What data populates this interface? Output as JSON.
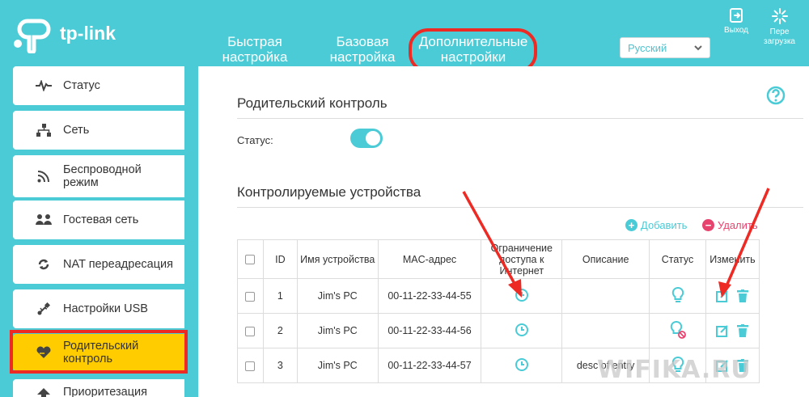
{
  "header": {
    "logo_text": "tp-link",
    "tabs": [
      {
        "line1": "Быстрая",
        "line2": "настройка"
      },
      {
        "line1": "Базовая",
        "line2": "настройка"
      },
      {
        "line1": "Дополнительные",
        "line2": "настройки"
      }
    ],
    "language": "Русский",
    "logout_label": "Выход",
    "reboot_line1": "Пере",
    "reboot_line2": "загрузка"
  },
  "sidebar": {
    "items": [
      {
        "label": "Статус",
        "icon": "pulse-icon"
      },
      {
        "label": "Сеть",
        "icon": "network-icon"
      },
      {
        "label": "Беспроводной режим",
        "icon": "wifi-icon"
      },
      {
        "label": "Гостевая сеть",
        "icon": "guest-network-icon"
      },
      {
        "label": "NAT переадресация",
        "icon": "nat-icon"
      },
      {
        "label": "Настройки USB",
        "icon": "usb-icon"
      },
      {
        "label": "Родительский контроль",
        "icon": "heart-hand-icon"
      },
      {
        "label": "Приоритезация",
        "icon": "priority-icon"
      }
    ]
  },
  "main": {
    "parental_title": "Родительский контроль",
    "status_label": "Статус:",
    "status_on": true,
    "devices_title": "Контролируемые устройства",
    "add_label": "Добавить",
    "delete_label": "Удалить",
    "columns": [
      "ID",
      "Имя устройства",
      "MAC-адрес",
      "Ограничение доступа к Интернет",
      "Описание",
      "Статус",
      "Изменить"
    ],
    "rows": [
      {
        "id": "1",
        "name": "Jim's PC",
        "mac": "00-11-22-33-44-55",
        "desc": "",
        "blocked": false
      },
      {
        "id": "2",
        "name": "Jim's PC",
        "mac": "00-11-22-33-44-56",
        "desc": "",
        "blocked": true
      },
      {
        "id": "3",
        "name": "Jim's PC",
        "mac": "00-11-22-33-44-57",
        "desc": "desc of entry",
        "blocked": false
      }
    ]
  },
  "colors": {
    "accent": "#4acbd6",
    "highlight": "#ffcc00",
    "annotation": "#ee2a24",
    "delete": "#e8436e"
  },
  "watermark": "WIFIKA.RU"
}
